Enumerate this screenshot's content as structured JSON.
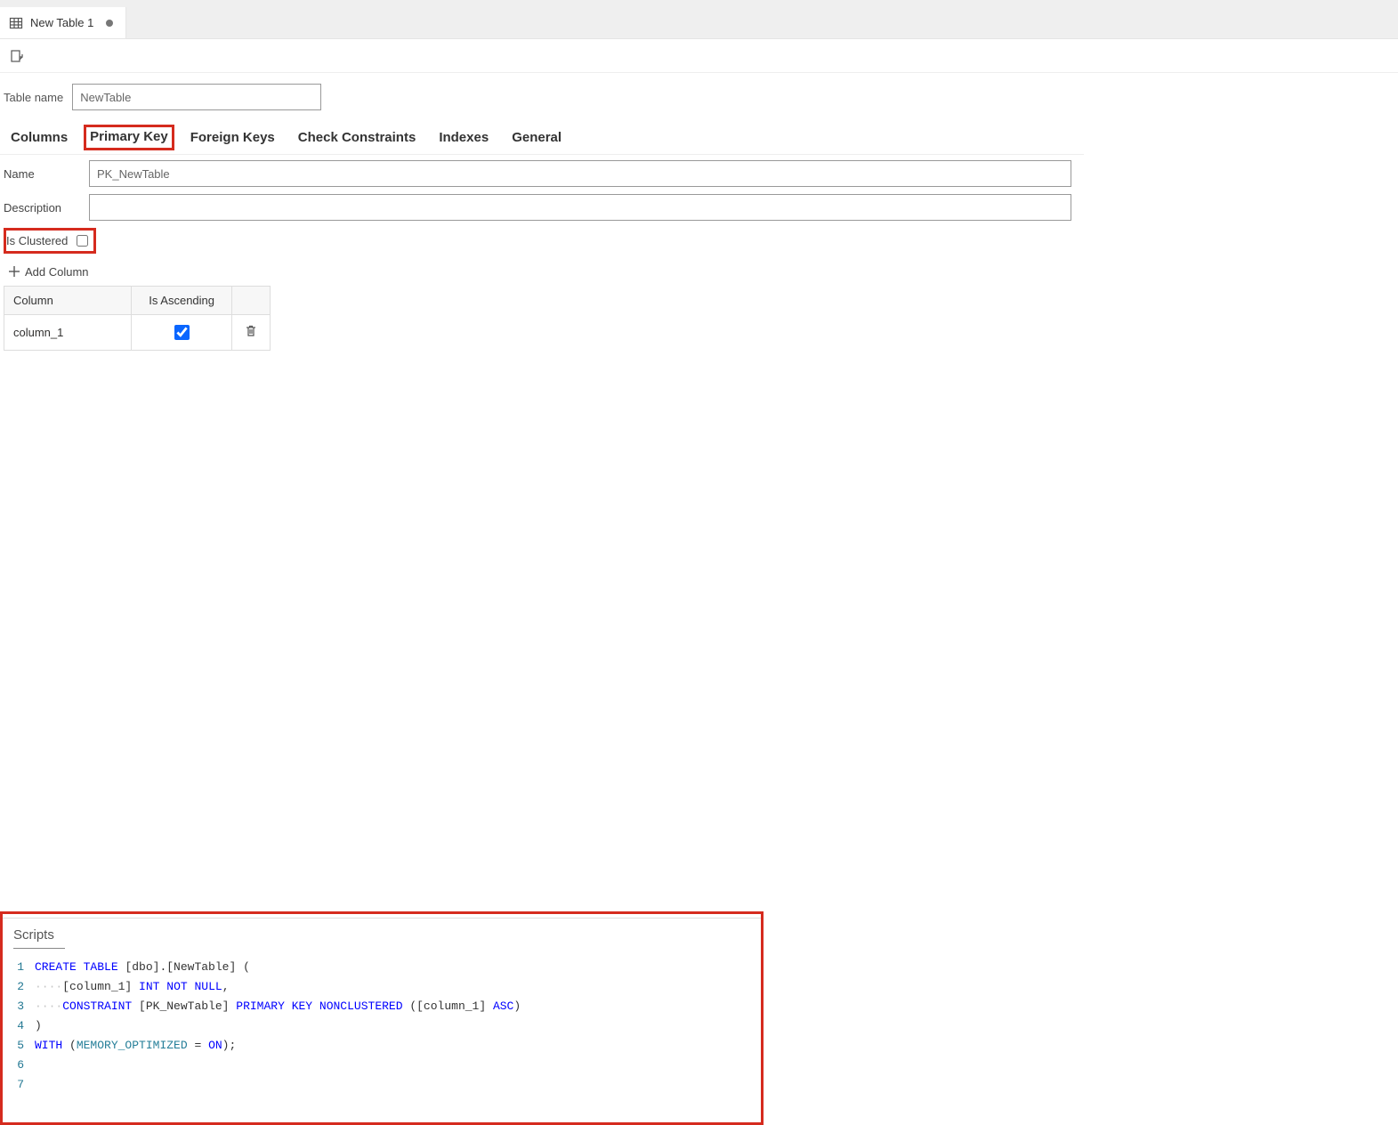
{
  "window": {
    "tab_title": "New Table 1",
    "dirty": true
  },
  "form": {
    "table_name_label": "Table name",
    "table_name_value": "NewTable"
  },
  "inner_tabs": {
    "columns": "Columns",
    "primary_key": "Primary Key",
    "foreign_keys": "Foreign Keys",
    "check_constraints": "Check Constraints",
    "indexes": "Indexes",
    "general": "General",
    "active": "primary_key"
  },
  "pk": {
    "name_label": "Name",
    "name_value": "PK_NewTable",
    "description_label": "Description",
    "description_value": "",
    "is_clustered_label": "Is Clustered",
    "is_clustered_checked": false,
    "add_column_label": "Add Column",
    "table_headers": {
      "column": "Column",
      "is_ascending": "Is Ascending"
    },
    "rows": [
      {
        "column": "column_1",
        "is_ascending": true
      }
    ]
  },
  "scripts": {
    "title": "Scripts",
    "lines": [
      {
        "n": 1,
        "segments": [
          {
            "t": "CREATE",
            "c": "kw"
          },
          {
            "t": " "
          },
          {
            "t": "TABLE",
            "c": "kw"
          },
          {
            "t": " [dbo].[NewTable] (",
            "c": "id"
          }
        ]
      },
      {
        "n": 2,
        "segments": [
          {
            "t": "····",
            "c": "dots"
          },
          {
            "t": "[column_1] ",
            "c": "id"
          },
          {
            "t": "INT",
            "c": "kw"
          },
          {
            "t": " "
          },
          {
            "t": "NOT",
            "c": "kw"
          },
          {
            "t": " "
          },
          {
            "t": "NULL",
            "c": "kw"
          },
          {
            "t": ",",
            "c": "id"
          }
        ]
      },
      {
        "n": 3,
        "segments": [
          {
            "t": "····",
            "c": "dots"
          },
          {
            "t": "CONSTRAINT",
            "c": "kw"
          },
          {
            "t": " [PK_NewTable] ",
            "c": "id"
          },
          {
            "t": "PRIMARY",
            "c": "kw"
          },
          {
            "t": " "
          },
          {
            "t": "KEY",
            "c": "kw"
          },
          {
            "t": " "
          },
          {
            "t": "NONCLUSTERED",
            "c": "kw"
          },
          {
            "t": " ([column_1] ",
            "c": "id"
          },
          {
            "t": "ASC",
            "c": "kw"
          },
          {
            "t": ")",
            "c": "id"
          }
        ]
      },
      {
        "n": 4,
        "segments": [
          {
            "t": ")",
            "c": "id"
          }
        ]
      },
      {
        "n": 5,
        "segments": [
          {
            "t": "WITH",
            "c": "kw"
          },
          {
            "t": " (",
            "c": "id"
          },
          {
            "t": "MEMORY_OPTIMIZED",
            "c": "fn"
          },
          {
            "t": " = ",
            "c": "id"
          },
          {
            "t": "ON",
            "c": "kw"
          },
          {
            "t": ");",
            "c": "id"
          }
        ]
      },
      {
        "n": 6,
        "segments": []
      },
      {
        "n": 7,
        "segments": []
      }
    ]
  },
  "icons": {
    "table": "table-icon",
    "publish": "publish-icon",
    "plus": "plus-icon",
    "trash": "trash-icon"
  }
}
